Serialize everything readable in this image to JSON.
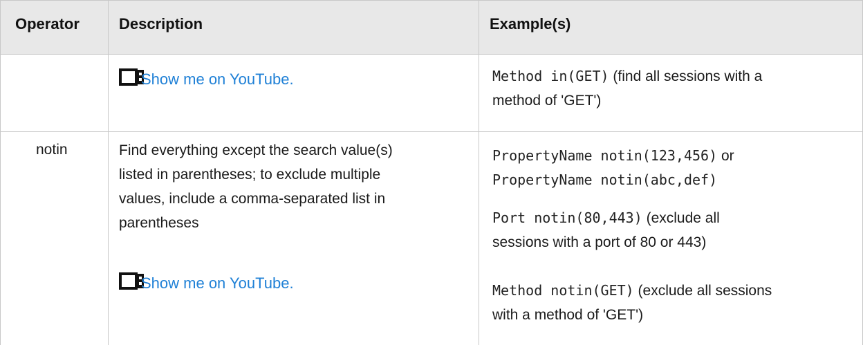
{
  "header": {
    "operator": "Operator",
    "description": "Description",
    "examples": "Example(s)"
  },
  "rows": [
    {
      "operator": "",
      "description_lines": [],
      "video_link": "Show me on YouTube.",
      "examples": [
        {
          "code": "Method in(GET)",
          "text": " (find all sessions with a",
          "text2": "method of 'GET')"
        }
      ]
    },
    {
      "operator": "notin",
      "description_lines": [
        "Find everything except the search value(s)",
        "listed in parentheses; to exclude multiple",
        "values, include a comma-separated list in",
        "parentheses"
      ],
      "video_link": "Show me on YouTube.",
      "examples": [
        {
          "code": "PropertyName notin(123,456)",
          "text": " or"
        },
        {
          "code": "PropertyName notin(abc,def)"
        },
        {
          "code": "Port notin(80,443)",
          "text": " (exclude all",
          "text2": "sessions with a port of 80 or 443)"
        },
        {
          "code": "Method notin(GET)",
          "text": " (exclude all sessions",
          "text2": "with a method of 'GET')"
        }
      ]
    }
  ],
  "icons": {
    "video": "video-camera-icon"
  },
  "colors": {
    "link": "#1f80d6",
    "header_bg": "#e8e8e8",
    "border": "#c8c8c8"
  }
}
